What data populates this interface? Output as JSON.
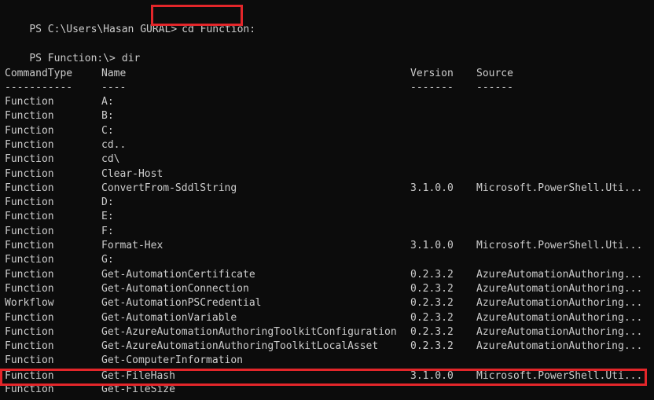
{
  "prompt1": {
    "prefix": "PS C:\\Users\\Hasan GURAL>",
    "command": "cd Function:"
  },
  "prompt2": {
    "prefix": "PS Function:\\>",
    "command": "dir"
  },
  "table": {
    "headers": {
      "type": "CommandType",
      "name": "Name",
      "version": "Version",
      "source": "Source"
    },
    "separators": {
      "type": "-----------",
      "name": "----",
      "version": "-------",
      "source": "------"
    },
    "rows": [
      {
        "type": "Function",
        "name": "A:",
        "version": "",
        "source": ""
      },
      {
        "type": "Function",
        "name": "B:",
        "version": "",
        "source": ""
      },
      {
        "type": "Function",
        "name": "C:",
        "version": "",
        "source": ""
      },
      {
        "type": "Function",
        "name": "cd..",
        "version": "",
        "source": ""
      },
      {
        "type": "Function",
        "name": "cd\\",
        "version": "",
        "source": ""
      },
      {
        "type": "Function",
        "name": "Clear-Host",
        "version": "",
        "source": ""
      },
      {
        "type": "Function",
        "name": "ConvertFrom-SddlString",
        "version": "3.1.0.0",
        "source": "Microsoft.PowerShell.Uti..."
      },
      {
        "type": "Function",
        "name": "D:",
        "version": "",
        "source": ""
      },
      {
        "type": "Function",
        "name": "E:",
        "version": "",
        "source": ""
      },
      {
        "type": "Function",
        "name": "F:",
        "version": "",
        "source": ""
      },
      {
        "type": "Function",
        "name": "Format-Hex",
        "version": "3.1.0.0",
        "source": "Microsoft.PowerShell.Uti..."
      },
      {
        "type": "Function",
        "name": "G:",
        "version": "",
        "source": ""
      },
      {
        "type": "Function",
        "name": "Get-AutomationCertificate",
        "version": "0.2.3.2",
        "source": "AzureAutomationAuthoring..."
      },
      {
        "type": "Function",
        "name": "Get-AutomationConnection",
        "version": "0.2.3.2",
        "source": "AzureAutomationAuthoring..."
      },
      {
        "type": "Workflow",
        "name": "Get-AutomationPSCredential",
        "version": "0.2.3.2",
        "source": "AzureAutomationAuthoring..."
      },
      {
        "type": "Function",
        "name": "Get-AutomationVariable",
        "version": "0.2.3.2",
        "source": "AzureAutomationAuthoring..."
      },
      {
        "type": "Function",
        "name": "Get-AzureAutomationAuthoringToolkitConfiguration",
        "version": "0.2.3.2",
        "source": "AzureAutomationAuthoring..."
      },
      {
        "type": "Function",
        "name": "Get-AzureAutomationAuthoringToolkitLocalAsset",
        "version": "0.2.3.2",
        "source": "AzureAutomationAuthoring..."
      },
      {
        "type": "Function",
        "name": "Get-ComputerInformation",
        "version": "",
        "source": ""
      },
      {
        "type": "Function",
        "name": "Get-FileHash",
        "version": "3.1.0.0",
        "source": "Microsoft.PowerShell.Uti..."
      },
      {
        "type": "Function",
        "name": "Get-FileSize",
        "version": "",
        "source": ""
      }
    ]
  },
  "colors": {
    "background": "#0c0c0c",
    "text": "#cccccc",
    "highlight": "#e3262a"
  }
}
